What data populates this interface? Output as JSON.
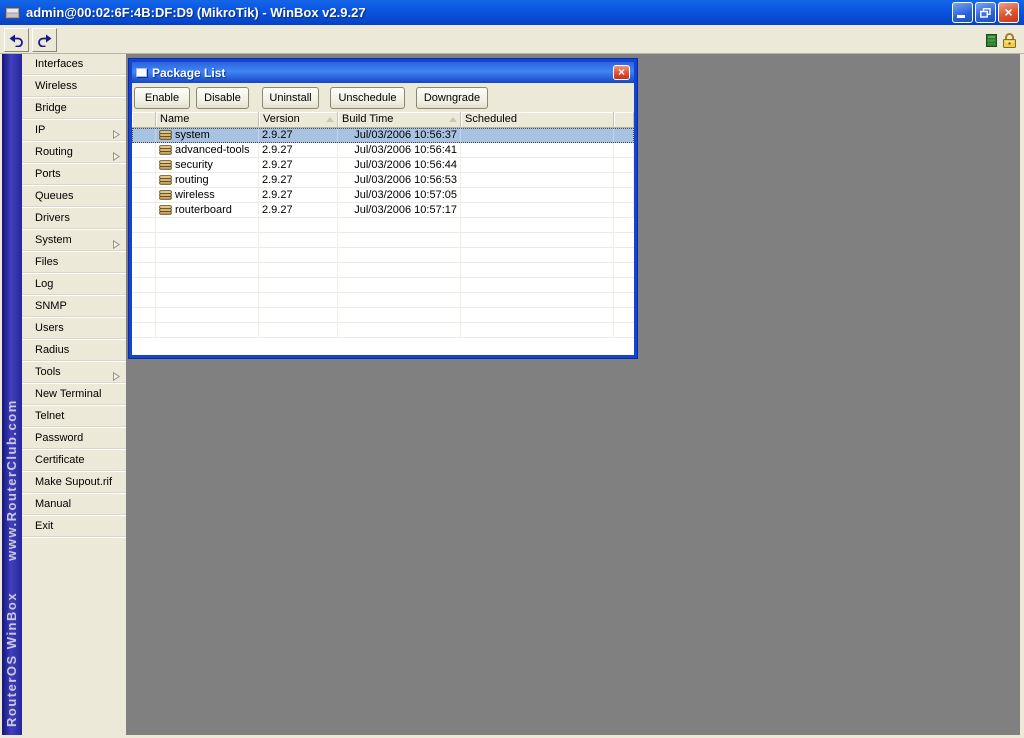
{
  "app": {
    "title": "admin@00:02:6F:4B:DF:D9 (MikroTik) - WinBox v2.9.27",
    "toolbar_icons": {
      "undo": "undo-arrow-icon",
      "redo": "redo-arrow-icon",
      "status": "green-status-icon",
      "lock": "padlock-icon"
    }
  },
  "branding_band": {
    "line_bottom": "RouterOS WinBox",
    "line_top": "www.RouterClub.com"
  },
  "sidebar": {
    "items": [
      {
        "label": "Interfaces",
        "has_submenu": false
      },
      {
        "label": "Wireless",
        "has_submenu": false
      },
      {
        "label": "Bridge",
        "has_submenu": false
      },
      {
        "label": "IP",
        "has_submenu": true
      },
      {
        "label": "Routing",
        "has_submenu": true
      },
      {
        "label": "Ports",
        "has_submenu": false
      },
      {
        "label": "Queues",
        "has_submenu": false
      },
      {
        "label": "Drivers",
        "has_submenu": false
      },
      {
        "label": "System",
        "has_submenu": true
      },
      {
        "label": "Files",
        "has_submenu": false
      },
      {
        "label": "Log",
        "has_submenu": false
      },
      {
        "label": "SNMP",
        "has_submenu": false
      },
      {
        "label": "Users",
        "has_submenu": false
      },
      {
        "label": "Radius",
        "has_submenu": false
      },
      {
        "label": "Tools",
        "has_submenu": true
      },
      {
        "label": "New Terminal",
        "has_submenu": false
      },
      {
        "label": "Telnet",
        "has_submenu": false
      },
      {
        "label": "Password",
        "has_submenu": false
      },
      {
        "label": "Certificate",
        "has_submenu": false
      },
      {
        "label": "Make Supout.rif",
        "has_submenu": false
      },
      {
        "label": "Manual",
        "has_submenu": false
      },
      {
        "label": "Exit",
        "has_submenu": false
      }
    ]
  },
  "package_window": {
    "title": "Package List",
    "buttons": [
      "Enable",
      "Disable",
      "Uninstall",
      "Unschedule",
      "Downgrade"
    ],
    "table": {
      "columns": [
        {
          "label": "",
          "field": "rowhead",
          "sort_icon": false
        },
        {
          "label": "Name",
          "field": "name",
          "sort_icon": false
        },
        {
          "label": "Version",
          "field": "version",
          "sort_icon": true
        },
        {
          "label": "Build Time",
          "field": "build_time",
          "sort_icon": true
        },
        {
          "label": "Scheduled",
          "field": "scheduled",
          "sort_icon": false
        },
        {
          "label": "",
          "field": "pad",
          "sort_icon": false
        }
      ],
      "rows": [
        {
          "icon": "package-icon",
          "name": "system",
          "version": "2.9.27",
          "build_time": "Jul/03/2006 10:56:37",
          "scheduled": ""
        },
        {
          "icon": "package-icon",
          "name": "advanced-tools",
          "version": "2.9.27",
          "build_time": "Jul/03/2006 10:56:41",
          "scheduled": ""
        },
        {
          "icon": "package-icon",
          "name": "security",
          "version": "2.9.27",
          "build_time": "Jul/03/2006 10:56:44",
          "scheduled": ""
        },
        {
          "icon": "package-icon",
          "name": "routing",
          "version": "2.9.27",
          "build_time": "Jul/03/2006 10:56:53",
          "scheduled": ""
        },
        {
          "icon": "package-icon",
          "name": "wireless",
          "version": "2.9.27",
          "build_time": "Jul/03/2006 10:57:05",
          "scheduled": ""
        },
        {
          "icon": "package-icon",
          "name": "routerboard",
          "version": "2.9.27",
          "build_time": "Jul/03/2006 10:57:17",
          "scheduled": ""
        }
      ],
      "selected_row_index": 0
    }
  },
  "colors": {
    "titlebar_blue": "#0A54E0",
    "window_border_blue": "#1243D6",
    "selection_blue": "#A8C2E2",
    "chrome_beige": "#ECE9D8",
    "desktop_gray": "#808080",
    "band_blue": "#2B2BA8",
    "close_red": "#D8492A"
  }
}
